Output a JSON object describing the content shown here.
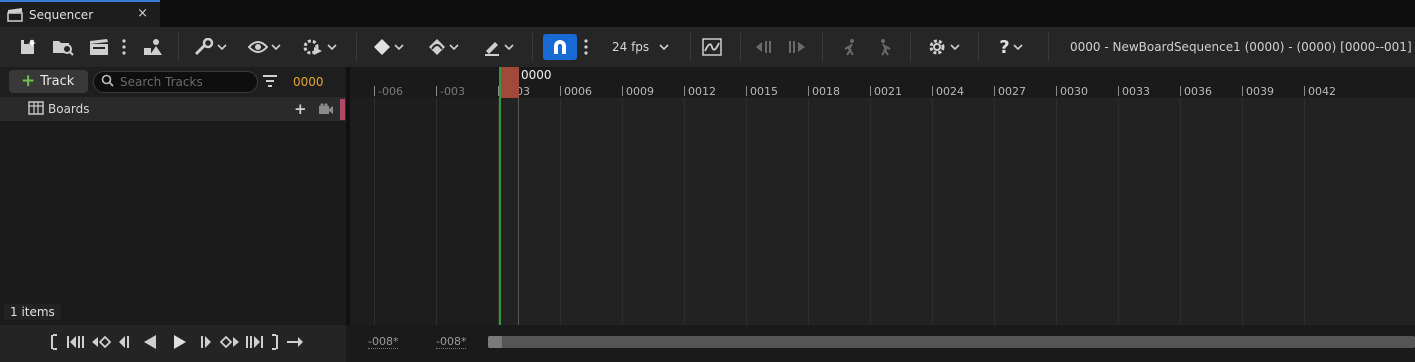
{
  "tab": {
    "title": "Sequencer",
    "close_glyph": "×",
    "icon": "clapperboard-icon"
  },
  "toolbar": {
    "fps_label": "24 fps",
    "sequence_title": "0000 - NewBoardSequence1 (0000) -  (0000) [0000--001]",
    "accent_color": "#1a6ad6"
  },
  "left_panel": {
    "add_track_label": "Track",
    "search_placeholder": "Search Tracks",
    "time_readout": "0000",
    "tracks": [
      {
        "label": "Boards",
        "color": "#b04a62"
      }
    ],
    "item_count": "1 items"
  },
  "timeline": {
    "playhead_label": "0000",
    "ticks": [
      "-006",
      "-003",
      "0003",
      "0006",
      "0009",
      "0012",
      "0015",
      "0018",
      "0021",
      "0024",
      "0027",
      "0030",
      "0033",
      "0036",
      "0039",
      "0042"
    ]
  },
  "bottom": {
    "range_start": "-008*",
    "range_end": "-008*"
  }
}
